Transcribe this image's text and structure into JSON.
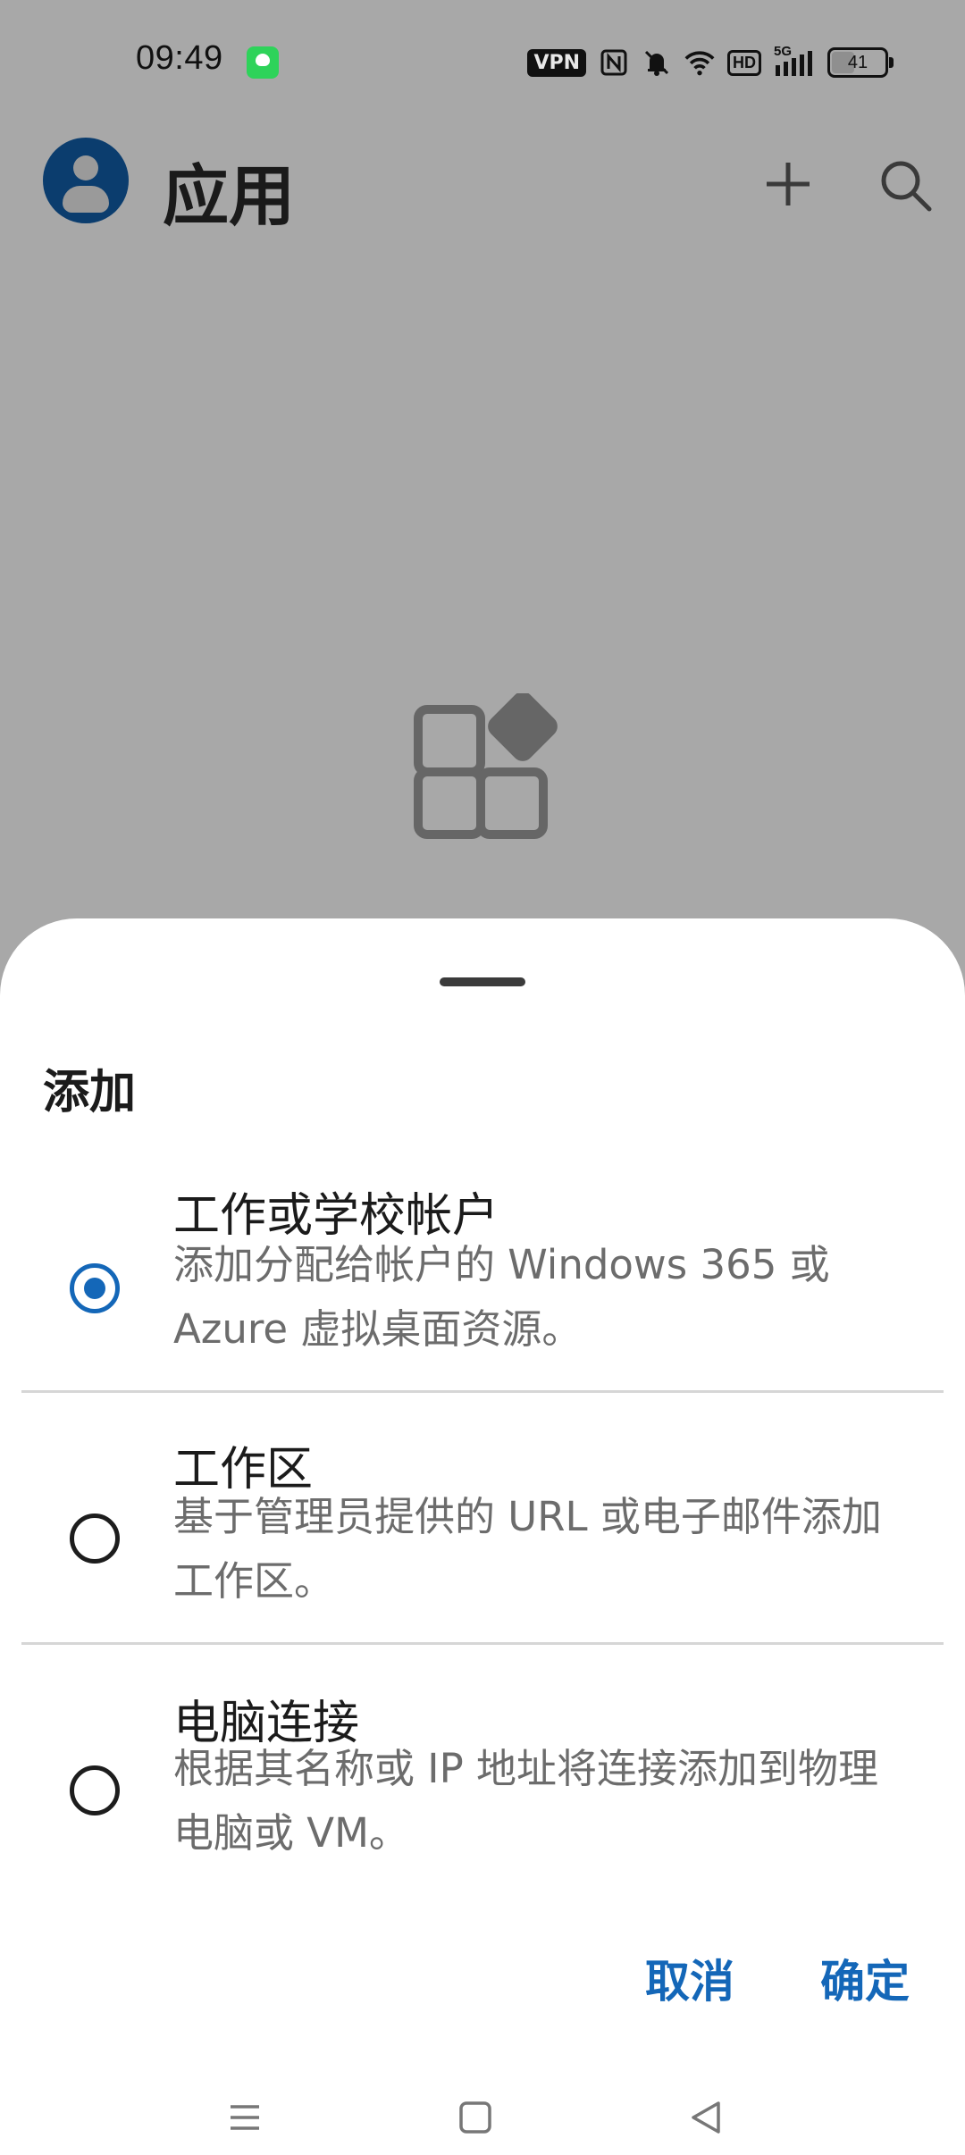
{
  "status_bar": {
    "time": "09:49",
    "vpn_label": "VPN",
    "hd_label": "HD",
    "network_label": "5G",
    "battery_level": "41",
    "icons": [
      "chat-notification-icon",
      "nfc-icon",
      "mute-icon",
      "wifi-icon",
      "hd-icon",
      "cellular-signal-icon",
      "battery-icon"
    ]
  },
  "app_bar": {
    "title": "应用",
    "icons": [
      "account-avatar-icon",
      "plus-icon",
      "search-icon"
    ]
  },
  "empty_state": {
    "icon": "apps-grid-icon"
  },
  "sheet": {
    "title": "添加",
    "options": [
      {
        "title": "工作或学校帐户",
        "desc": "添加分配给帐户的 Windows 365 或 Azure 虚拟桌面资源。",
        "selected": true
      },
      {
        "title": "工作区",
        "desc": "基于管理员提供的 URL 或电子邮件添加工作区。",
        "selected": false
      },
      {
        "title": "电脑连接",
        "desc": "根据其名称或 IP 地址将连接添加到物理电脑或 VM。",
        "selected": false
      }
    ],
    "cancel_label": "取消",
    "confirm_label": "确定"
  },
  "colors": {
    "accent": "#1467b8",
    "scrim": "#a8a8a8",
    "avatar": "#0b3d6e",
    "text_primary": "#1b1b1b",
    "text_secondary": "#6c6c6c"
  },
  "nav_bar": {
    "icons": [
      "menu-icon",
      "home-icon",
      "back-icon"
    ]
  }
}
